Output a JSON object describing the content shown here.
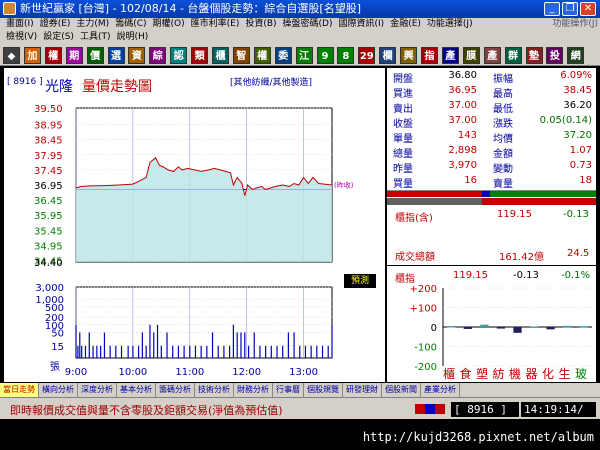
{
  "window": {
    "title": "新世紀贏家 [台灣] - 102/08/14 - 台盤個股走勢：綜合自選股[名望股]",
    "buttons": [
      "_",
      "❐",
      "✕"
    ]
  },
  "menu1": [
    "畫面(I)",
    "證券(E)",
    "主力(M)",
    "籌碼(C)",
    "期權(O)",
    "匯市利率(E)",
    "投資(B)",
    "操盤密碼(D)",
    "國際資訊(I)",
    "金融(E)",
    "功能選擇(J)"
  ],
  "menu1_right": "功能操作(J)",
  "menu2": [
    "檢視(V)",
    "設定(S)",
    "工具(T)",
    "說明(H)"
  ],
  "toolbar": [
    "◆",
    "加",
    "權",
    "期",
    "價",
    "選",
    "資",
    "綜",
    "認",
    "類",
    "櫃",
    "智",
    "權",
    "委",
    "江",
    "9",
    "8",
    "29",
    "欄",
    "興",
    "指",
    "產",
    "膜",
    "產",
    "群",
    "墊",
    "投",
    "網"
  ],
  "toolbar_colors": [
    "#404040",
    "#d06000",
    "#a00000",
    "#a000a0",
    "#006000",
    "#0040a0",
    "#a06000",
    "#800080",
    "#008080",
    "#a00000",
    "#006060",
    "#804000",
    "#406000",
    "#004080",
    "#008000",
    "#008000",
    "#008000",
    "#a00000",
    "#204080",
    "#806000",
    "#a00000",
    "#000080",
    "#404000",
    "#804040",
    "#006040",
    "#802020",
    "#600060",
    "#204020"
  ],
  "chart": {
    "code": "[ 8916 ]",
    "name": "光隆",
    "title": "量價走勢圖",
    "subtitle": "[其他紡織/其他製造]",
    "ref_label": "(昨收)",
    "volume_badge": "預測",
    "volume_footer": "張"
  },
  "chart_data": {
    "type": "line",
    "price_ticks": [
      "39.50",
      "38.95",
      "38.45",
      "37.95",
      "37.45",
      "36.95",
      "36.45",
      "35.95",
      "35.45",
      "34.95",
      "34.45",
      "34.40"
    ],
    "price_tick_colors": [
      "#c00000",
      "#c00000",
      "#c00000",
      "#c00000",
      "#c00000",
      "#000000",
      "#008000",
      "#008000",
      "#008000",
      "#008000",
      "#008000",
      "#000000"
    ],
    "volume_ticks": [
      "3,000",
      "1,000",
      "500",
      "200",
      "100",
      "50",
      "15"
    ],
    "time_ticks": [
      "9:00",
      "10:00",
      "11:00",
      "12:00",
      "13:00"
    ],
    "ylim": [
      34.4,
      39.5
    ],
    "prev_close": 36.8,
    "price_series": [
      [
        0,
        36.85
      ],
      [
        5,
        36.9
      ],
      [
        15,
        36.92
      ],
      [
        30,
        36.93
      ],
      [
        45,
        36.95
      ],
      [
        60,
        36.98
      ],
      [
        68,
        37.1
      ],
      [
        74,
        37.2
      ],
      [
        78,
        37.7
      ],
      [
        84,
        37.85
      ],
      [
        88,
        37.6
      ],
      [
        92,
        37.55
      ],
      [
        97,
        37.45
      ],
      [
        103,
        37.4
      ],
      [
        108,
        37.55
      ],
      [
        112,
        37.45
      ],
      [
        118,
        37.5
      ],
      [
        125,
        37.45
      ],
      [
        132,
        37.4
      ],
      [
        140,
        37.45
      ],
      [
        146,
        37.5
      ],
      [
        152,
        37.45
      ],
      [
        158,
        37.4
      ],
      [
        163,
        37.35
      ],
      [
        166,
        36.95
      ],
      [
        170,
        37.2
      ],
      [
        175,
        37.0
      ],
      [
        178,
        36.6
      ],
      [
        181,
        36.95
      ],
      [
        186,
        36.8
      ],
      [
        190,
        36.85
      ],
      [
        196,
        36.9
      ],
      [
        200,
        36.8
      ],
      [
        205,
        36.85
      ],
      [
        210,
        36.9
      ],
      [
        218,
        36.95
      ],
      [
        225,
        36.9
      ],
      [
        230,
        37.0
      ],
      [
        235,
        36.95
      ],
      [
        240,
        37.2
      ],
      [
        245,
        37.0
      ],
      [
        250,
        37.2
      ],
      [
        256,
        37.0
      ],
      [
        270,
        36.95
      ]
    ],
    "volume_series": [
      [
        0,
        100
      ],
      [
        2,
        15
      ],
      [
        4,
        50
      ],
      [
        6,
        15
      ],
      [
        10,
        15
      ],
      [
        14,
        50
      ],
      [
        18,
        15
      ],
      [
        22,
        15
      ],
      [
        26,
        15
      ],
      [
        30,
        50
      ],
      [
        36,
        15
      ],
      [
        42,
        15
      ],
      [
        48,
        15
      ],
      [
        55,
        15
      ],
      [
        60,
        15
      ],
      [
        66,
        15
      ],
      [
        70,
        50
      ],
      [
        74,
        15
      ],
      [
        78,
        100
      ],
      [
        82,
        50
      ],
      [
        86,
        100
      ],
      [
        90,
        15
      ],
      [
        96,
        50
      ],
      [
        102,
        15
      ],
      [
        108,
        15
      ],
      [
        114,
        15
      ],
      [
        120,
        15
      ],
      [
        126,
        15
      ],
      [
        132,
        15
      ],
      [
        138,
        15
      ],
      [
        144,
        50
      ],
      [
        150,
        15
      ],
      [
        156,
        15
      ],
      [
        162,
        15
      ],
      [
        166,
        100
      ],
      [
        170,
        50
      ],
      [
        174,
        50
      ],
      [
        178,
        50
      ],
      [
        182,
        15
      ],
      [
        188,
        50
      ],
      [
        194,
        15
      ],
      [
        200,
        15
      ],
      [
        206,
        15
      ],
      [
        212,
        15
      ],
      [
        218,
        15
      ],
      [
        224,
        50
      ],
      [
        230,
        50
      ],
      [
        236,
        15
      ],
      [
        242,
        15
      ],
      [
        248,
        15
      ],
      [
        254,
        15
      ],
      [
        260,
        15
      ],
      [
        266,
        15
      ],
      [
        270,
        100
      ]
    ],
    "x_range_minutes": [
      0,
      270
    ]
  },
  "quote": {
    "rows": [
      {
        "l1": "開盤",
        "v1": "36.80",
        "c1": "black",
        "l2": "振幅",
        "v2": "6.09%",
        "c2": "red"
      },
      {
        "l1": "買進",
        "v1": "36.95",
        "c1": "red",
        "l2": "最高",
        "v2": "38.45",
        "c2": "red"
      },
      {
        "l1": "賣出",
        "v1": "37.00",
        "c1": "red",
        "l2": "最低",
        "v2": "36.20",
        "c2": "black"
      },
      {
        "l1": "收盤",
        "v1": "37.00",
        "c1": "red",
        "l2": "漲跌",
        "v2": "0.05(0.14)",
        "c2": "green"
      },
      {
        "l1": "單量",
        "v1": "143",
        "c1": "red",
        "l2": "均價",
        "v2": "37.20",
        "c2": "green"
      },
      {
        "l1": "總量",
        "v1": "2,898",
        "c1": "red",
        "l2": "金額",
        "v2": "1.07",
        "c2": "red"
      },
      {
        "l1": "昨量",
        "v1": "3,970",
        "c1": "red",
        "l2": "變動",
        "v2": "0.73",
        "c2": "red"
      },
      {
        "l1": "買量",
        "v1": "16",
        "c1": "red",
        "l2": "賣量",
        "v2": "18",
        "c2": "red"
      }
    ],
    "index1": {
      "label": "櫃指(含)",
      "value": "119.15",
      "change": "-0.13"
    },
    "turnover": {
      "label": "成交總額",
      "value": "161.42億",
      "change": "24.5"
    },
    "index2": {
      "label": "櫃指",
      "value": "119.15",
      "change": "-0.13",
      "pct": "-0.1%"
    },
    "sector_ticks": [
      "+200",
      "+100",
      "0",
      "-100",
      "-200"
    ],
    "sector_labels": [
      "櫃",
      "食",
      "塑",
      "紡",
      "機",
      "器",
      "化",
      "生",
      "玻"
    ],
    "sector_colors": [
      "#c00000",
      "#c00000",
      "#c00000",
      "#c00000",
      "#c00000",
      "#c00000",
      "#c00000",
      "#c00000",
      "#008000"
    ],
    "sector_values": [
      5,
      -10,
      12,
      -8,
      -30,
      3,
      -12,
      6,
      4
    ]
  },
  "tabs": [
    "當日走勢",
    "橫向分析",
    "深度分析",
    "基本分析",
    "籌碼分析",
    "技術分析",
    "財務分析",
    "行事曆",
    "個股規覽",
    "研發理財",
    "個股新聞",
    "產業分析"
  ],
  "status": {
    "message": "即時報價成交值與量不含零股及鉅額交易(淨值為預估值)",
    "code": "[ 8916 ]",
    "time": "14:19:14/"
  },
  "watermark": "http://kujd3268.pixnet.net/album"
}
